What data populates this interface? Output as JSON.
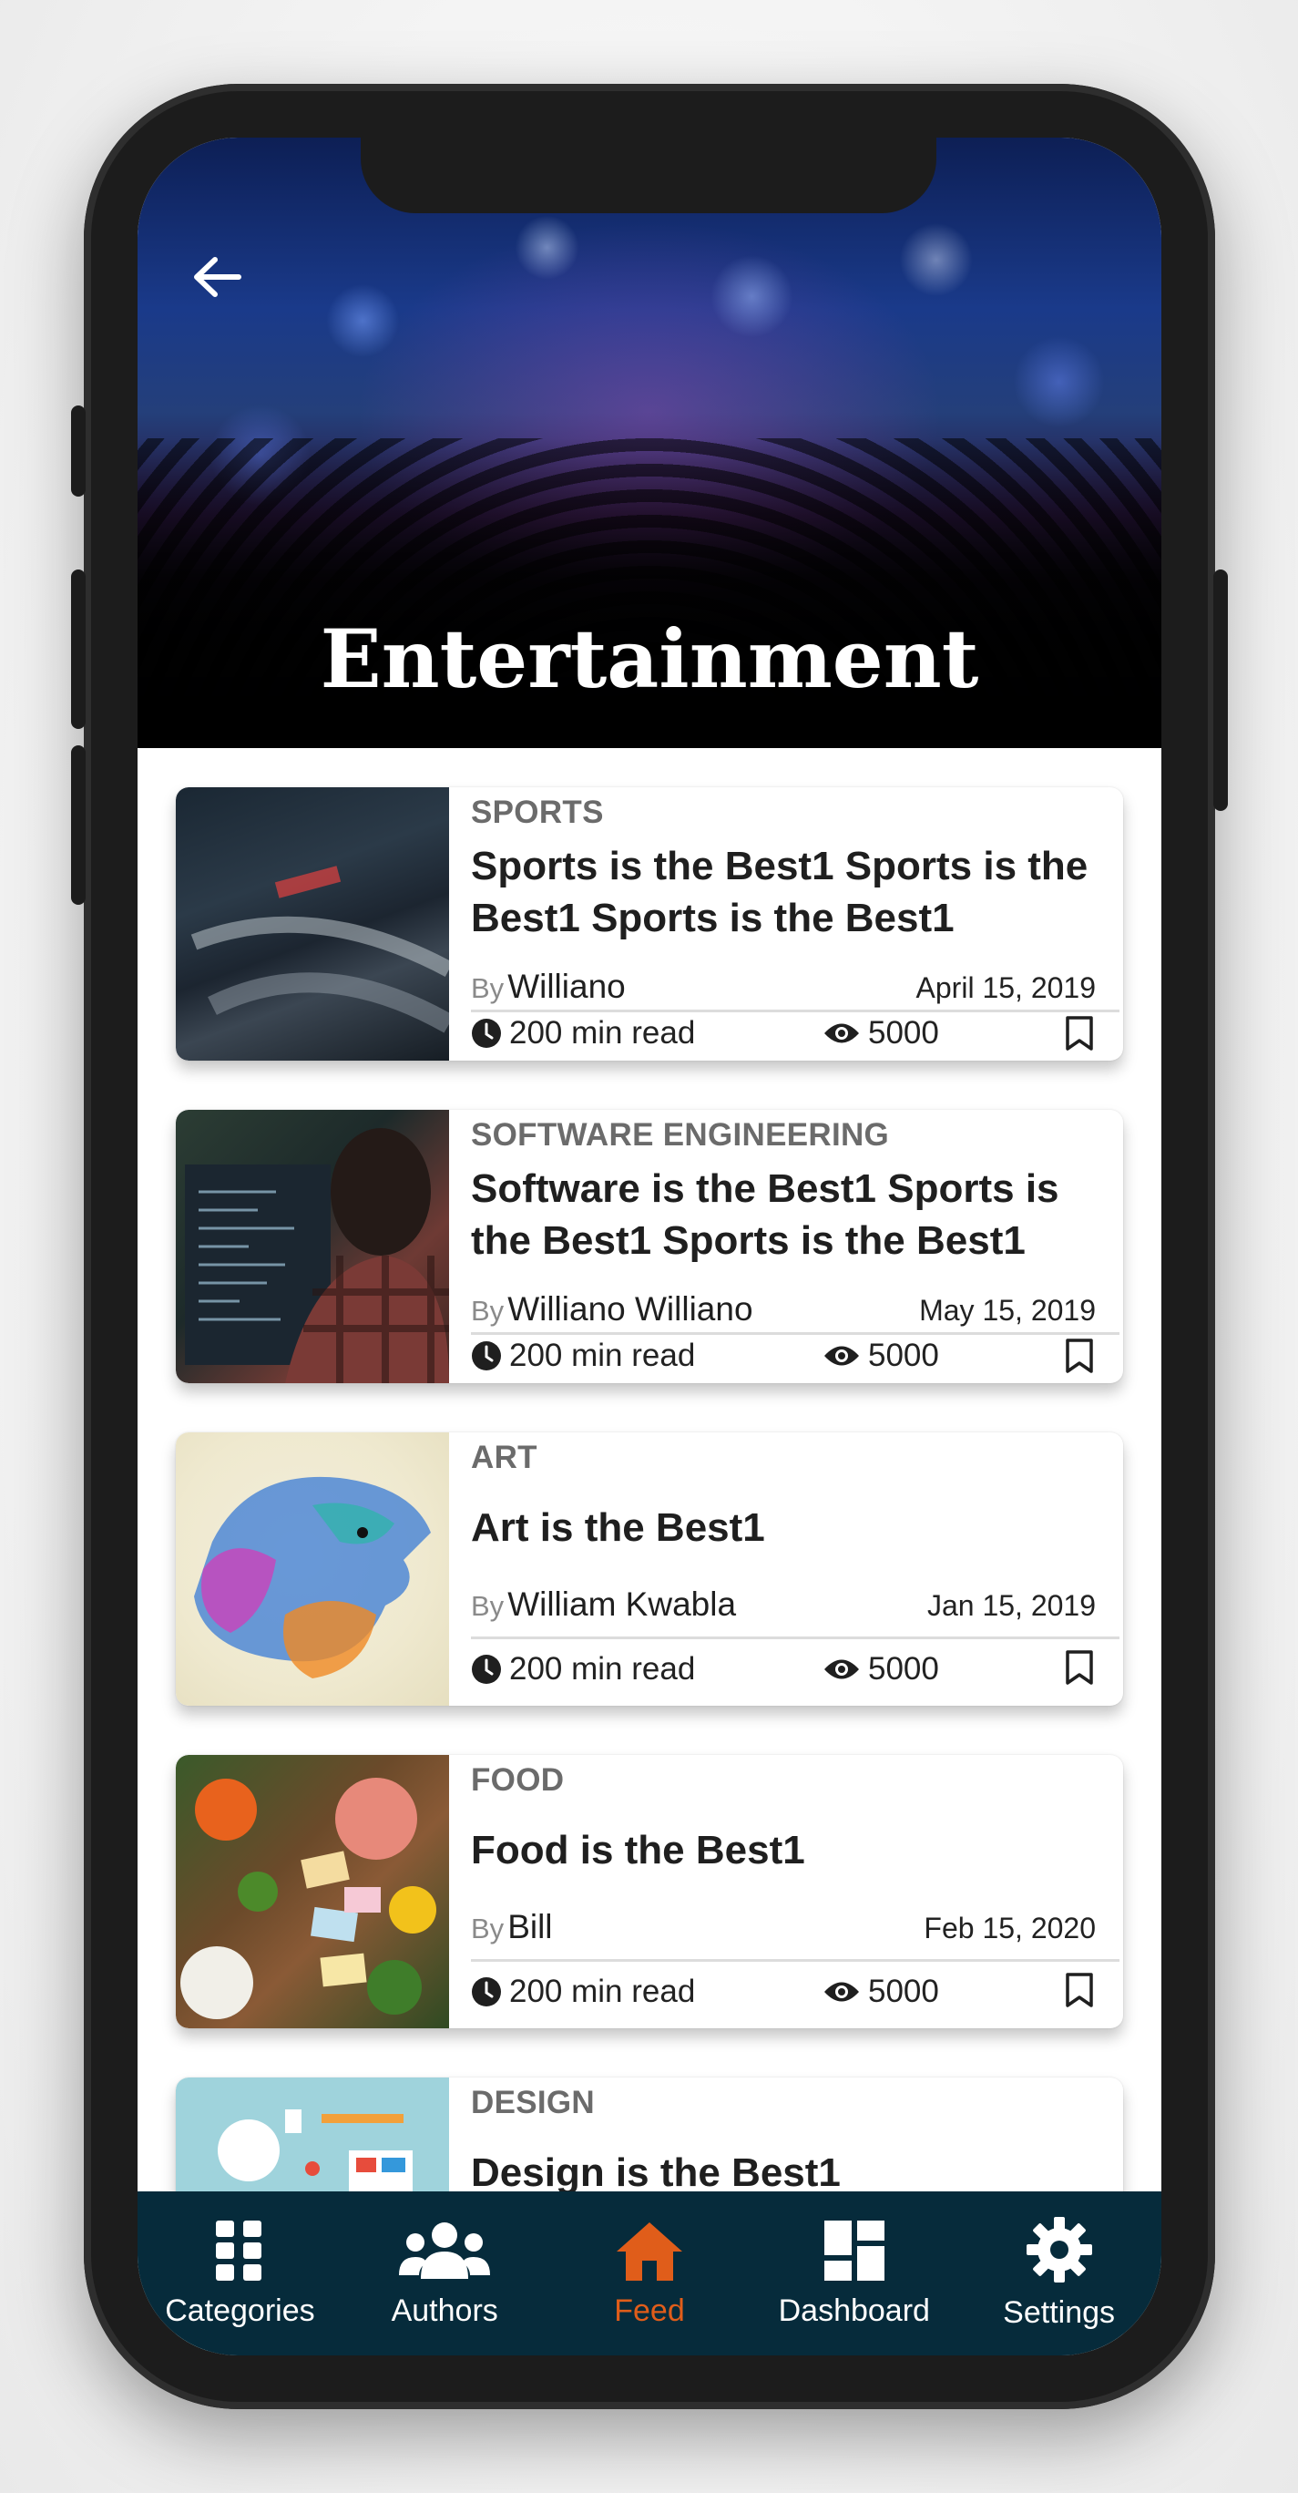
{
  "hero": {
    "title": "Entertainment"
  },
  "articles": [
    {
      "category": "SPORTS",
      "title": "Sports is the Best1 Sports is the Best1 Sports is the Best1",
      "by": "By",
      "author": "Williano",
      "date": "April 15, 2019",
      "read": "200 min read",
      "views": "5000"
    },
    {
      "category": "SOFTWARE ENGINEERING",
      "title": "Software is the Best1 Sports is the Best1 Sports is the Best1",
      "by": "By",
      "author": "Williano Williano",
      "date": "May 15, 2019",
      "read": "200 min read",
      "views": "5000"
    },
    {
      "category": "ART",
      "title": "Art is the Best1",
      "by": "By",
      "author": "William Kwabla",
      "date": "Jan 15, 2019",
      "read": "200 min read",
      "views": "5000"
    },
    {
      "category": "FOOD",
      "title": "Food is the Best1",
      "by": "By",
      "author": "Bill",
      "date": "Feb 15, 2020",
      "read": "200 min read",
      "views": "5000"
    },
    {
      "category": "DESIGN",
      "title": "Design is the Best1"
    }
  ],
  "nav": [
    {
      "label": "Categories",
      "icon": "grid-icon"
    },
    {
      "label": "Authors",
      "icon": "people-icon"
    },
    {
      "label": "Feed",
      "icon": "home-icon",
      "active": true
    },
    {
      "label": "Dashboard",
      "icon": "dashboard-icon"
    },
    {
      "label": "Settings",
      "icon": "gear-icon"
    }
  ],
  "colors": {
    "nav_bg": "#062b3b",
    "accent": "#e05d1a"
  }
}
